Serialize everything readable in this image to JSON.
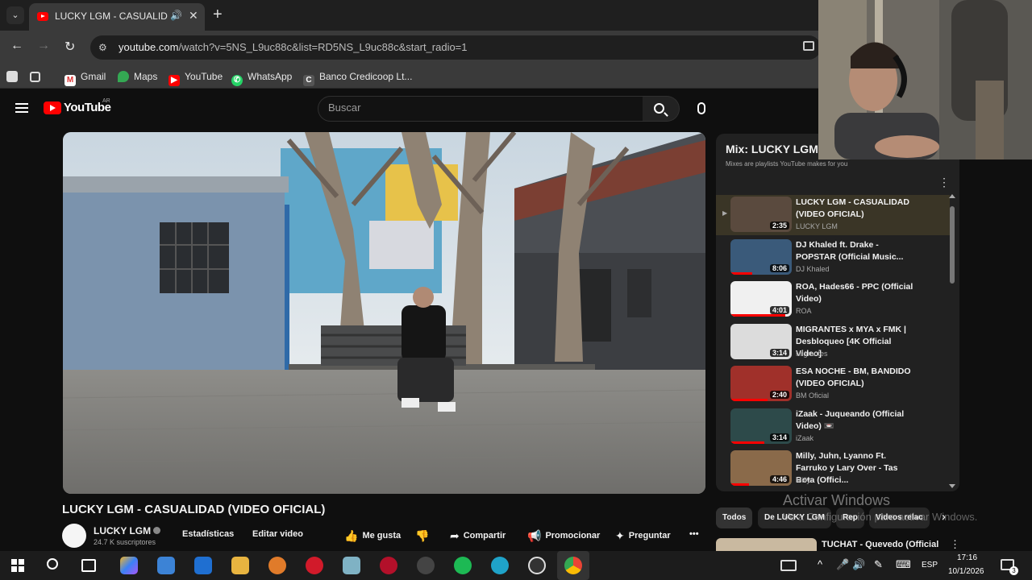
{
  "browser": {
    "tab_title": "LUCKY LGM - CASUALIDAD",
    "url_host": "youtube.com",
    "url_path": "/watch?v=5NS_L9uc88c&list=RD5NS_L9uc88c&start_radio=1",
    "bookmarks": [
      "Gmail",
      "Maps",
      "YouTube",
      "WhatsApp",
      "Banco Credicoop Lt..."
    ]
  },
  "youtube": {
    "logo": "YouTube",
    "region": "AR",
    "search_placeholder": "Buscar"
  },
  "video": {
    "title": "LUCKY LGM - CASUALIDAD (VIDEO OFICIAL)",
    "channel": "LUCKY LGM",
    "subscribers": "24.7 K suscriptores",
    "actions": {
      "stats": "Estadísticas",
      "edit": "Editar video",
      "like": "Me gusta",
      "share": "Compartir",
      "promote": "Promocionar",
      "ask": "Preguntar"
    }
  },
  "playlist": {
    "title": "Mix: LUCKY LGM",
    "subtitle": "Mixes are playlists YouTube makes for you",
    "items": [
      {
        "title": "LUCKY LGM - CASUALIDAD (VIDEO OFICIAL)",
        "channel": "LUCKY LGM",
        "duration": "2:35",
        "marker": "▶",
        "progress": 0
      },
      {
        "title": "DJ Khaled ft. Drake - POPSTAR (Official Music...",
        "channel": "DJ Khaled",
        "duration": "8:06",
        "marker": "",
        "progress": 0.35
      },
      {
        "title": "ROA, Hades66 - PPC (Official Video)",
        "channel": "ROA",
        "duration": "4:01",
        "marker": "",
        "progress": 0.9
      },
      {
        "title": "MIGRANTES x MYA x FMK | Desbloqueo [4K Official Video]",
        "channel": "Migrantes",
        "duration": "3:14",
        "marker": "",
        "progress": 0
      },
      {
        "title": "ESA NOCHE - BM, BANDIDO (VIDEO OFICIAL)",
        "channel": "BM Oficial",
        "duration": "2:40",
        "marker": "",
        "progress": 0.6
      },
      {
        "title": "iZaak - Juqueando (Official Video) 📼",
        "channel": "iZaak",
        "duration": "3:14",
        "marker": "",
        "progress": 0.55
      },
      {
        "title": "Milly, Juhn, Lyanno Ft. Farruko y Lary Over - Tas Bota (Offici...",
        "channel": "Milly",
        "duration": "4:46",
        "marker": "",
        "progress": 0.3
      }
    ]
  },
  "chips": [
    "Todos",
    "De LUCKY LGM",
    "Rep",
    "Videos relac"
  ],
  "next_video": {
    "title": "TUCHAT - Quevedo (Official"
  },
  "watermark": {
    "line1": "Activar Windows",
    "line2": "Ve a Configuración para activar Windows."
  },
  "taskbar": {
    "lang": "ESP",
    "time": "17:16",
    "date": "10/1/2026",
    "notifications": "3"
  },
  "colors": {
    "yt_red": "#ff0000",
    "background": "#0f0f0f",
    "panel": "#212121"
  }
}
